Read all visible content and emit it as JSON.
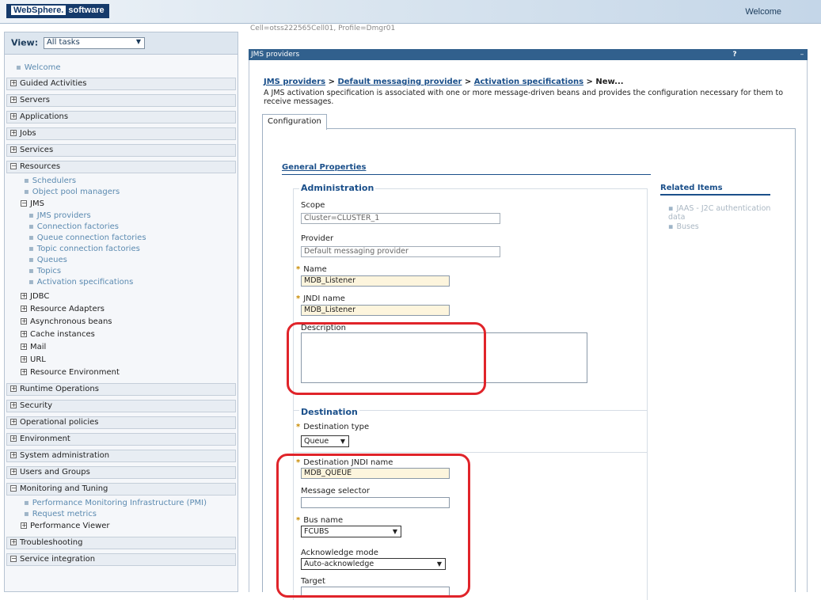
{
  "banner": {
    "logo_brand": "WebSphere.",
    "logo_suffix": "software",
    "welcome": "Welcome"
  },
  "nav": {
    "view_label": "View:",
    "view_value": "All tasks",
    "welcome_link": "Welcome",
    "groups_top": [
      "Guided Activities",
      "Servers",
      "Applications",
      "Jobs",
      "Services"
    ],
    "resources": "Resources",
    "resources_items": [
      "Schedulers",
      "Object pool managers"
    ],
    "jms": "JMS",
    "jms_items": [
      "JMS providers",
      "Connection factories",
      "Queue connection factories",
      "Topic connection factories",
      "Queues",
      "Topics",
      "Activation specifications"
    ],
    "resources_more": [
      "JDBC",
      "Resource Adapters",
      "Asynchronous beans",
      "Cache instances",
      "Mail",
      "URL",
      "Resource Environment"
    ],
    "groups_mid": [
      "Runtime Operations",
      "Security",
      "Operational policies",
      "Environment",
      "System administration",
      "Users and Groups"
    ],
    "monitoring": "Monitoring and Tuning",
    "monitoring_items": [
      "Performance Monitoring Infrastructure (PMI)",
      "Request metrics"
    ],
    "perf_viewer": "Performance Viewer",
    "groups_bottom": [
      "Troubleshooting",
      "Service integration"
    ]
  },
  "main": {
    "cell_info": "Cell=otss222565Cell01, Profile=Dmgr01",
    "panel_title": "JMS providers",
    "help_icon": "?",
    "min_icon": "–",
    "breadcrumb": [
      "JMS providers",
      "Default messaging provider",
      "Activation specifications",
      "New..."
    ],
    "breadcrumb_sep": " > ",
    "description": "A JMS activation specification is associated with one or more message-driven beans and provides the configuration necessary for them to receive messages.",
    "tab": "Configuration",
    "general_properties": "General Properties",
    "administration": "Administration",
    "scope_label": "Scope",
    "scope_value": "Cluster=CLUSTER_1",
    "provider_label": "Provider",
    "provider_value": "Default messaging provider",
    "name_label": "Name",
    "name_value": "MDB_Listener",
    "jndi_label": "JNDI name",
    "jndi_value": "MDB_Listener",
    "description_label": "Description",
    "destination": "Destination",
    "dest_type_label": "Destination type",
    "dest_type_value": "Queue",
    "dest_jndi_label": "Destination JNDI name",
    "dest_jndi_value": "MDB_QUEUE",
    "msg_selector_label": "Message selector",
    "bus_label": "Bus name",
    "bus_value": "FCUBS",
    "ack_label": "Acknowledge mode",
    "ack_value": "Auto-acknowledge",
    "target_label": "Target",
    "required_mark": "*",
    "related_heading": "Related Items",
    "related_items": [
      "JAAS - J2C authentication data",
      "Buses"
    ]
  },
  "colors": {
    "title_bar": "#31608d",
    "link": "#1a4f8a",
    "highlight_box": "#e0242a",
    "required_field_bg": "#fdf5dd"
  }
}
